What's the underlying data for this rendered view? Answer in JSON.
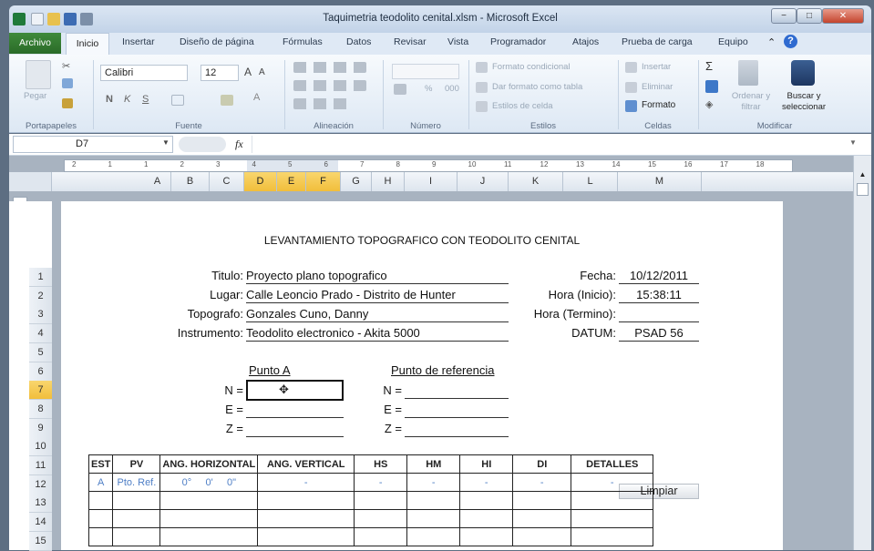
{
  "window": {
    "title": "Taquimetria teodolito cenital.xlsm - Microsoft Excel",
    "controls": [
      "−",
      "□",
      "✕"
    ]
  },
  "ribbon": {
    "file_tab": "Archivo",
    "tabs": [
      "Inicio",
      "Insertar",
      "Diseño de página",
      "Fórmulas",
      "Datos",
      "Revisar",
      "Vista",
      "Programador",
      "Atajos",
      "Prueba de carga",
      "Equipo"
    ],
    "clipboard": {
      "paste": "Pegar",
      "group": "Portapapeles"
    },
    "font": {
      "name": "Calibri",
      "size": "12",
      "group": "Fuente",
      "bold": "N",
      "italic": "K",
      "underline": "S"
    },
    "alignment": {
      "group": "Alineación"
    },
    "number": {
      "group": "Número",
      "percent": "%",
      "thousands": "000"
    },
    "styles": {
      "conditional": "Formato condicional",
      "table": "Dar formato como tabla",
      "cell": "Estilos de celda",
      "group": "Estilos"
    },
    "cells": {
      "insert": "Insertar",
      "delete": "Eliminar",
      "format": "Formato",
      "group": "Celdas"
    },
    "editing": {
      "sum": "Σ",
      "sort": "Ordenar y filtrar",
      "find": "Buscar y seleccionar",
      "group": "Modificar"
    }
  },
  "formula_bar": {
    "name_box": "D7",
    "fx": "fx",
    "value": ""
  },
  "columns": [
    "A",
    "B",
    "C",
    "D",
    "E",
    "F",
    "G",
    "H",
    "I",
    "J",
    "K",
    "L",
    "M"
  ],
  "selected_columns": [
    "D",
    "E",
    "F"
  ],
  "rows": [
    "1",
    "2",
    "3",
    "4",
    "5",
    "6",
    "7",
    "8",
    "9",
    "10",
    "11",
    "12",
    "13",
    "14",
    "15"
  ],
  "selected_row": "7",
  "ruler_marks": [
    "2",
    "1",
    "1",
    "2",
    "3",
    "4",
    "5",
    "6",
    "7",
    "8",
    "9",
    "10",
    "11",
    "12",
    "13",
    "14",
    "15",
    "16",
    "17",
    "18"
  ],
  "sheet": {
    "heading": "LEVANTAMIENTO TOPOGRAFICO CON TEODOLITO CENITAL",
    "fields": [
      {
        "label": "Titulo:",
        "value": "Proyecto plano topografico"
      },
      {
        "label": "Lugar:",
        "value": "Calle Leoncio Prado - Distrito de Hunter"
      },
      {
        "label": "Topografo:",
        "value": "Gonzales Cuno, Danny"
      },
      {
        "label": "Instrumento:",
        "value": "Teodolito electronico - Akita 5000"
      }
    ],
    "right_fields": [
      {
        "label": "Fecha:",
        "value": "10/12/2011"
      },
      {
        "label": "Hora (Inicio):",
        "value": "15:38:11"
      },
      {
        "label": "Hora (Termino):",
        "value": ""
      },
      {
        "label": "DATUM:",
        "value": "PSAD 56"
      }
    ],
    "point_a": {
      "title": "Punto A",
      "labels": [
        "N =",
        "E =",
        "Z ="
      ]
    },
    "point_ref": {
      "title": "Punto de referencia",
      "labels": [
        "N =",
        "E =",
        "Z ="
      ]
    },
    "clear_button": "Limpiar",
    "table": {
      "headers": [
        "EST",
        "PV",
        "ANG. HORIZONTAL",
        "ANG. VERTICAL",
        "HS",
        "HM",
        "HI",
        "DI",
        "DETALLES"
      ],
      "first_row": {
        "est": "A",
        "pv": "Pto. Ref.",
        "ang_h": [
          "0°",
          "0'",
          "0\""
        ],
        "ang_v": "-",
        "hs": "-",
        "hm": "-",
        "hi": "-",
        "di": "-",
        "det": "-"
      }
    }
  }
}
